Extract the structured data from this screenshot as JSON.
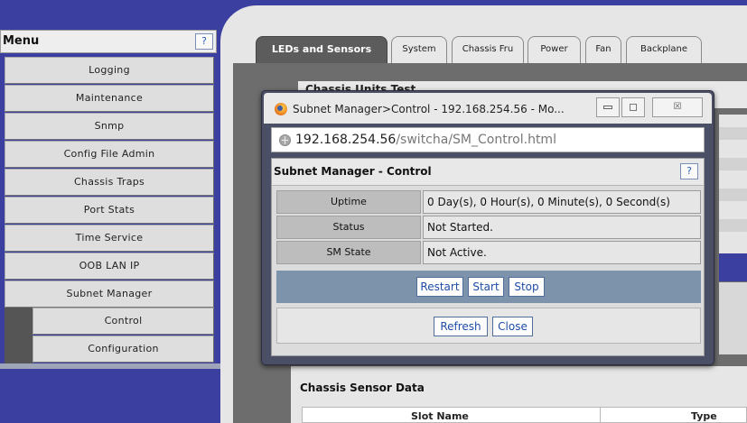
{
  "menu": {
    "title": "Menu",
    "help": "?",
    "items": [
      {
        "label": "Logging"
      },
      {
        "label": "Maintenance"
      },
      {
        "label": "Snmp"
      },
      {
        "label": "Config File Admin"
      },
      {
        "label": "Chassis Traps"
      },
      {
        "label": "Port Stats"
      },
      {
        "label": "Time Service"
      },
      {
        "label": "OOB LAN IP"
      },
      {
        "label": "Subnet Manager"
      }
    ],
    "subitems": [
      {
        "label": "Control"
      },
      {
        "label": "Configuration"
      }
    ]
  },
  "tabs": [
    {
      "label": "LEDs and Sensors",
      "active": true
    },
    {
      "label": "System"
    },
    {
      "label": "Chassis Fru"
    },
    {
      "label": "Power"
    },
    {
      "label": "Fan"
    },
    {
      "label": "Backplane"
    }
  ],
  "content": {
    "heading": "Chassis Units Test",
    "sensor_section_title": "Chassis Sensor Data",
    "columns": [
      "Slot Name",
      "Type"
    ]
  },
  "popup": {
    "window_title": "Subnet Manager>Control - 192.168.254.56 - Mo...",
    "close_glyph": "☒",
    "url_host": "192.168.254.56",
    "url_path": "/switcha/SM_Control.html",
    "panel_title": "Subnet Manager - Control",
    "help": "?",
    "rows": [
      {
        "label": "Uptime",
        "value": "0 Day(s), 0 Hour(s), 0 Minute(s), 0 Second(s)"
      },
      {
        "label": "Status",
        "value": "Not Started."
      },
      {
        "label": "SM State",
        "value": "Not Active."
      }
    ],
    "actions": [
      "Restart",
      "Start",
      "Stop"
    ],
    "bottom_actions": [
      "Refresh",
      "Close"
    ]
  },
  "colors": {
    "menu_background": "#3a3fa0",
    "action_bar": "#7d93ac",
    "link_blue": "#1f4da8"
  }
}
